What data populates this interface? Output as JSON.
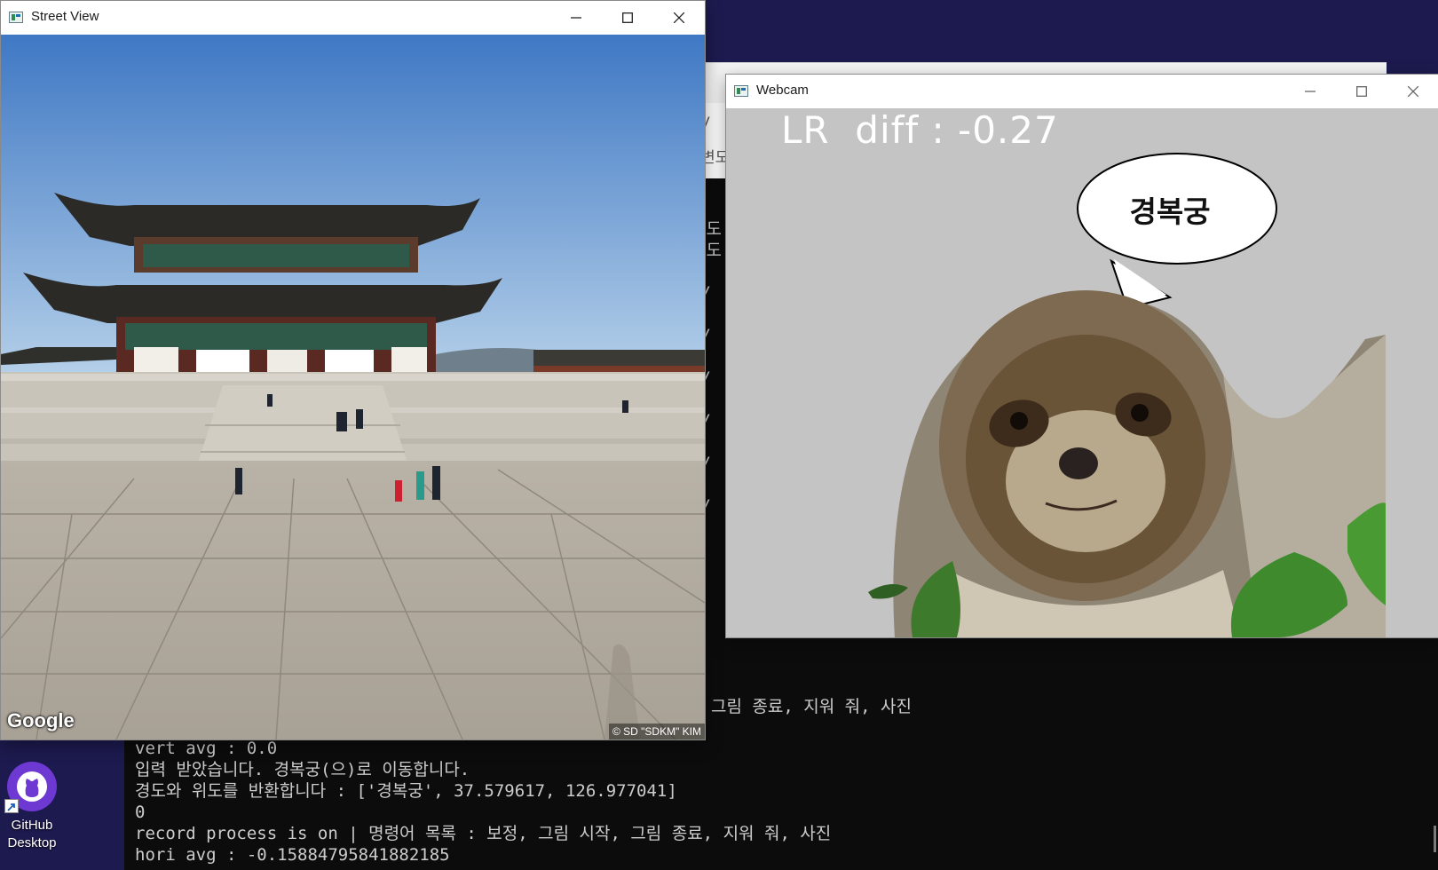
{
  "terminal": {
    "lines_top": [
      "그림 종료, 지워 줘, 사진"
    ],
    "lines": [
      "vert avg : 0.0",
      "입력 받았습니다. 경복궁(으)로 이동합니다.",
      "경도와 위도를 반환합니다 : ['경복궁', 37.579617, 126.977041]",
      "0",
      "record process is on | 명령어 목록 : 보정, 그림 시작, 그림 종료, 지워 줘, 사진",
      "hori avg : -0.15884795841882185"
    ],
    "fragments": [
      "변도",
      "변도",
      "g/",
      "g/",
      "g/",
      "g/",
      "g/",
      "g/",
      "그",
      ".",
      "그"
    ]
  },
  "back_window": {
    "fragments": [
      "y",
      "변도"
    ]
  },
  "street_view": {
    "title": "Street View",
    "logo": "Google",
    "copyright": "© SD \"SDKM\" KIM"
  },
  "webcam": {
    "title": "Webcam",
    "overlay": "LR  diff : -0.27",
    "bubble": "경복궁"
  },
  "desktop": {
    "icon_label_1": "GitHub",
    "icon_label_2": "Desktop"
  },
  "colors": {
    "desktop_bg": "#1d1a4f",
    "terminal_bg": "#0c0c0c",
    "terminal_fg": "#cccccc",
    "webcam_bg": "#c4c4c4",
    "github_purple": "#6e38d3"
  },
  "icons": [
    "window-icon",
    "minimize-icon",
    "maximize-icon",
    "close-icon",
    "github-icon",
    "shortcut-arrow-icon"
  ]
}
